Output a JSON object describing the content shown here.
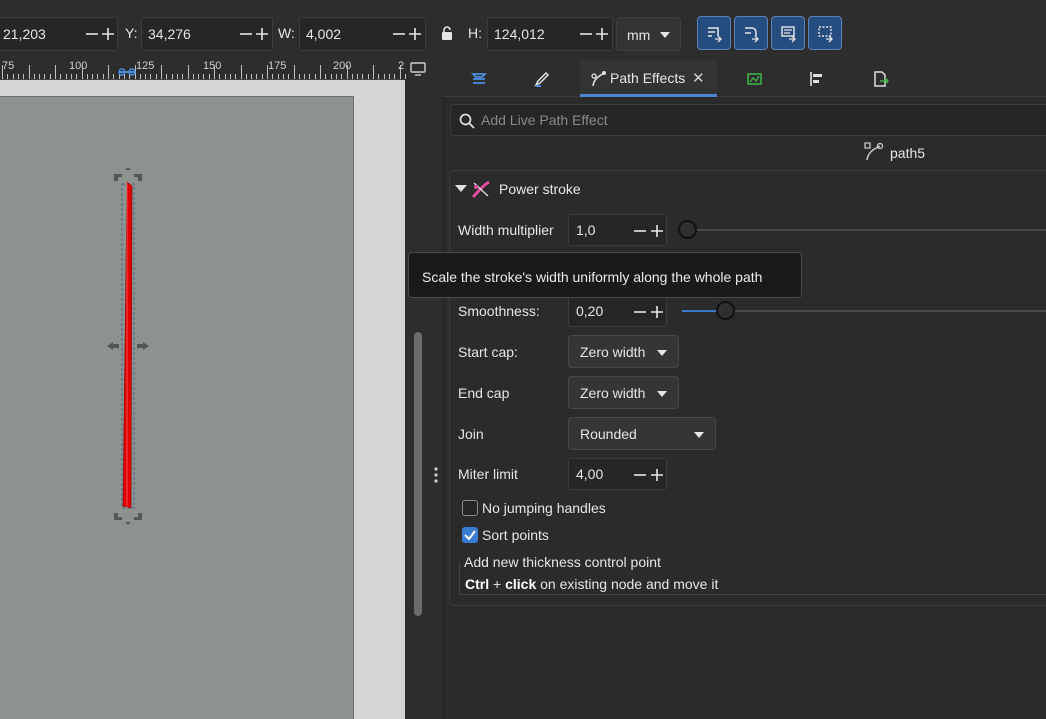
{
  "toolbar": {
    "x_value": "21,203",
    "y_label": "Y:",
    "y_value": "34,276",
    "w_label": "W:",
    "w_value": "4,002",
    "h_label": "H:",
    "h_value": "124,012",
    "unit": "mm",
    "icons": [
      "scale-stroke-icon",
      "scale-corners-icon",
      "move-gradients-icon",
      "move-patterns-icon"
    ]
  },
  "ruler": {
    "labels": [
      "75",
      "100",
      "125",
      "150",
      "175",
      "200",
      "2"
    ]
  },
  "panel": {
    "tabs": [
      {
        "name": "layers-tab",
        "icon": "layers-icon"
      },
      {
        "name": "fill-stroke-tab",
        "icon": "fill-stroke-icon"
      },
      {
        "name": "path-effects-tab",
        "icon": "path-effects-icon",
        "label": "Path Effects",
        "active": true
      },
      {
        "name": "export-image-tab",
        "icon": "image-icon"
      },
      {
        "name": "align-tab",
        "icon": "align-icon"
      },
      {
        "name": "export-tab",
        "icon": "export-icon"
      }
    ],
    "search_placeholder": "Add Live Path Effect",
    "object_name": "path5",
    "effect": {
      "title": "Power stroke",
      "width_multiplier_label": "Width multiplier",
      "width_multiplier_value": "1,0",
      "width_multiplier_slider": 0.0,
      "smoothness_label": "Smoothness:",
      "smoothness_value": "0,20",
      "smoothness_slider": 0.2,
      "start_cap_label": "Start cap:",
      "start_cap_value": "Zero width",
      "end_cap_label": "End cap",
      "end_cap_value": "Zero width",
      "join_label": "Join",
      "join_value": "Rounded",
      "miter_label": "Miter limit",
      "miter_value": "4,00",
      "no_jumping_label": "No jumping handles",
      "no_jumping_checked": false,
      "sort_points_label": "Sort points",
      "sort_points_checked": true,
      "hint_title": "Add new thickness control point",
      "hint_key1": "Ctrl",
      "hint_plus": " + ",
      "hint_key2": "click",
      "hint_rest": " on existing node and move it"
    },
    "tooltip": "Scale the stroke's width uniformly along the whole path"
  },
  "colors": {
    "accent": "#3a7bd5",
    "stroke_red": "#e00000",
    "page": "#8c938f"
  }
}
